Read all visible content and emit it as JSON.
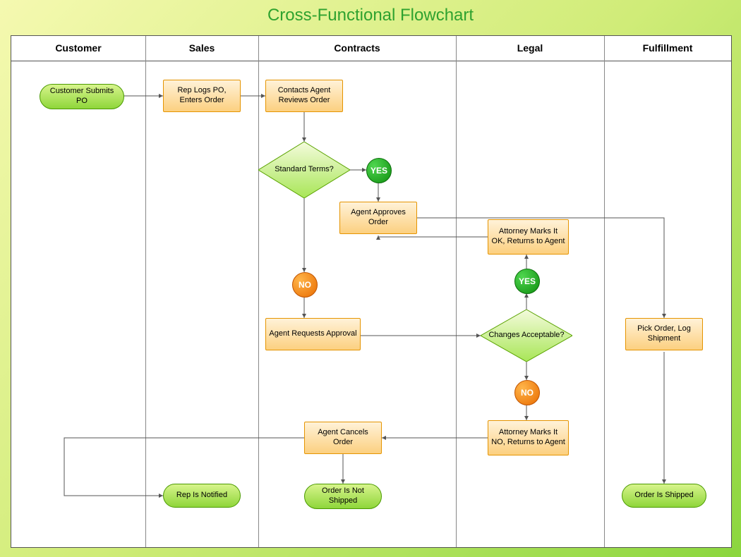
{
  "title": "Cross-Functional Flowchart",
  "lanes": [
    "Customer",
    "Sales",
    "Contracts",
    "Legal",
    "Fulfillment"
  ],
  "nodes": {
    "customer_submits": "Customer Submits PO",
    "rep_logs": "Rep Logs PO, Enters Order",
    "contacts_agent": "Contacts Agent Reviews Order",
    "standard_terms": "Standard Terms?",
    "agent_approves": "Agent Approves Order",
    "agent_requests": "Agent Requests Approval",
    "agent_cancels": "Agent Cancels Order",
    "attorney_ok": "Attorney Marks It OK, Returns to Agent",
    "changes_acceptable": "Changes Acceptable?",
    "attorney_no": "Attorney Marks It NO, Returns to Agent",
    "pick_order": "Pick Order, Log Shipment",
    "rep_notified": "Rep Is Notified",
    "order_not_shipped": "Order Is Not Shipped",
    "order_shipped": "Order Is Shipped"
  },
  "badges": {
    "yes": "YES",
    "no": "NO"
  }
}
